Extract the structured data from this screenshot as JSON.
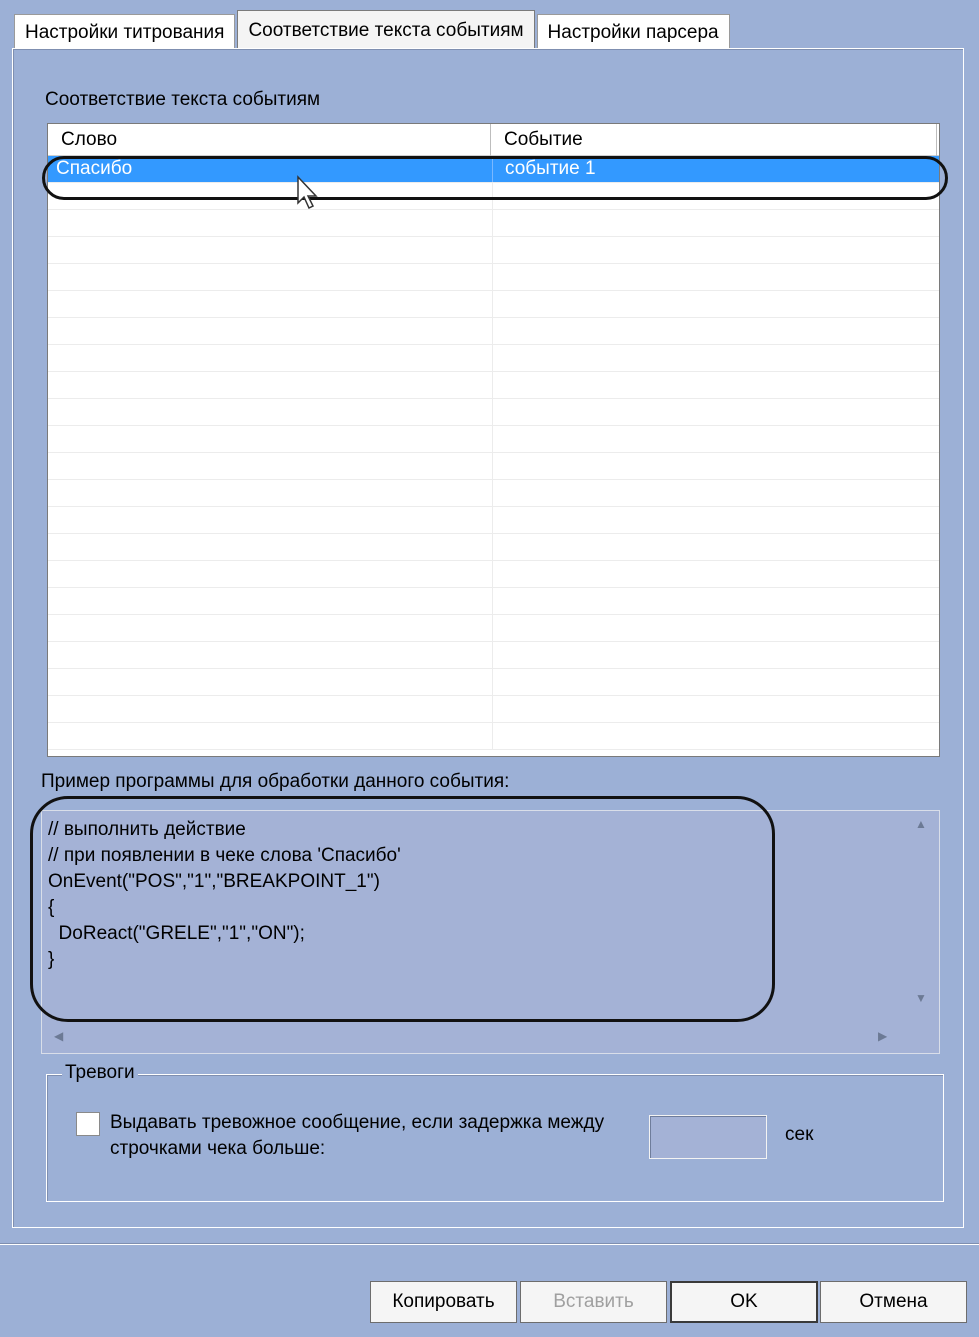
{
  "tabs": [
    {
      "label": "Настройки титрования"
    },
    {
      "label": "Соответствие текста событиям"
    },
    {
      "label": "Настройки парсера"
    }
  ],
  "mapping": {
    "section_label": "Соответствие текста событиям",
    "columns": [
      "Слово",
      "Событие"
    ],
    "rows": [
      {
        "word": "Спасибо",
        "event": "событие 1"
      }
    ]
  },
  "code_example": {
    "label": "Пример программы для обработки данного события:",
    "lines": [
      "// выполнить действие",
      "// при появлении в чеке слова 'Спасибо'",
      "OnEvent(\"POS\",\"1\",\"BREAKPOINT_1\")",
      "{",
      "  DoReact(\"GRELE\",\"1\",\"ON\");",
      "}"
    ]
  },
  "alarms": {
    "group_label": "Тревоги",
    "checkbox_label": "Выдавать тревожное сообщение, если задержка между строчками чека больше:",
    "checked": false,
    "delay_value": "",
    "unit": "сек"
  },
  "buttons": {
    "copy": "Копировать",
    "paste": "Вставить",
    "ok": "OK",
    "cancel": "Отмена"
  },
  "colors": {
    "background": "#9cb0d6",
    "selection": "#3399ff"
  }
}
